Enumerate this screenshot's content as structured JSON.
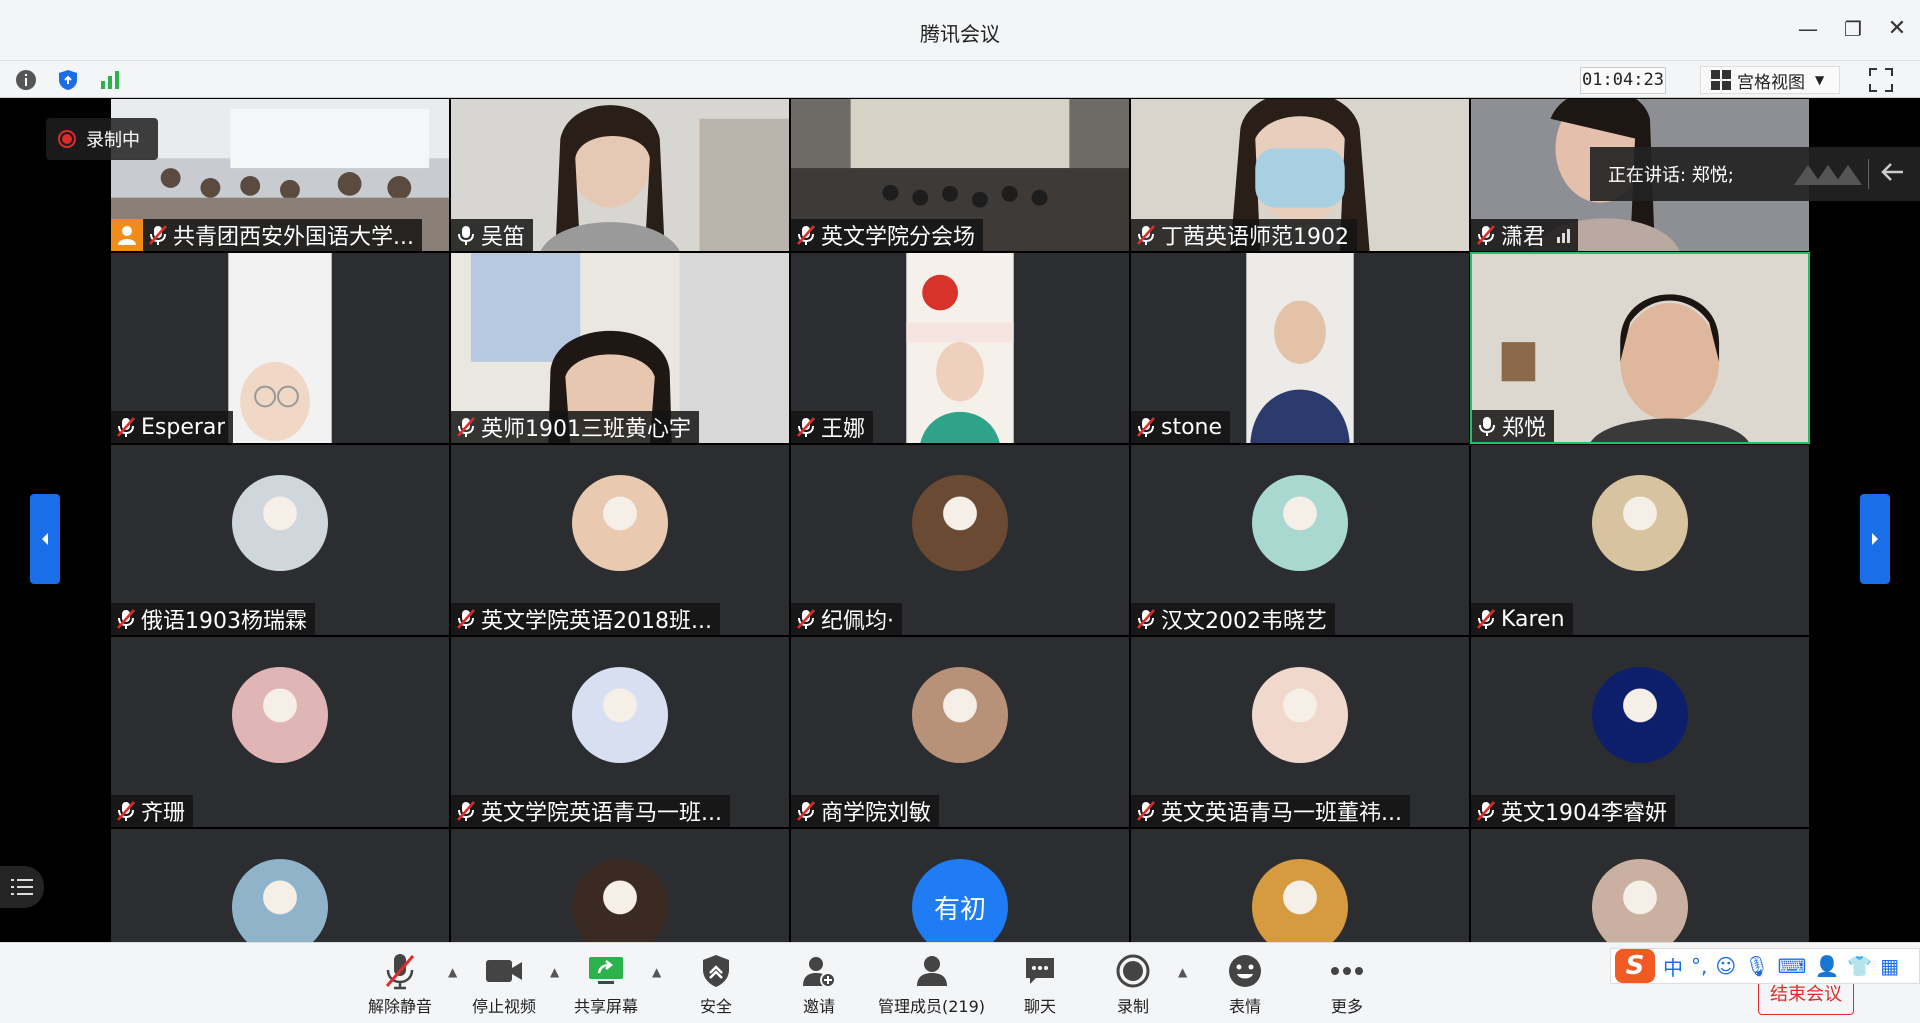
{
  "window": {
    "title": "腾讯会议",
    "min_icon": "minimize-icon",
    "max_icon": "restore-icon",
    "close_icon": "close-icon"
  },
  "subbar": {
    "timer": "01:04:23",
    "view_label": "宫格视图"
  },
  "recording": {
    "label": "录制中"
  },
  "speaking": {
    "label": "正在讲话: 郑悦;"
  },
  "tiles": [
    {
      "name": "共青团西安外国语大学...",
      "mic": "muted",
      "host": true,
      "video": "classroom"
    },
    {
      "name": "吴笛",
      "mic": "on",
      "video": "person"
    },
    {
      "name": "英文学院分会场",
      "mic": "muted",
      "video": "hall"
    },
    {
      "name": "丁茜英语师范1902",
      "mic": "muted",
      "video": "mask"
    },
    {
      "name": "潇君",
      "mic": "muted",
      "video": "person2",
      "level": true
    },
    {
      "name": "Esperar",
      "mic": "muted",
      "video": "narrow"
    },
    {
      "name": "英师1901三班黄心宇",
      "mic": "muted",
      "video": "room"
    },
    {
      "name": "王娜",
      "mic": "muted",
      "video": "narrow2"
    },
    {
      "name": "stone",
      "mic": "muted",
      "video": "narrow3"
    },
    {
      "name": "郑悦",
      "mic": "on",
      "video": "speaker",
      "speaking": true
    },
    {
      "name": "俄语1903杨瑞霖",
      "mic": "muted",
      "avatar": "#cfd6dc"
    },
    {
      "name": "英文学院英语2018班...",
      "mic": "muted",
      "avatar": "#e9c9b0"
    },
    {
      "name": "纪佩均·",
      "mic": "muted",
      "avatar": "#6b4a34"
    },
    {
      "name": "汉文2002韦晓艺",
      "mic": "muted",
      "avatar": "#a8d8d0"
    },
    {
      "name": "Karen",
      "mic": "muted",
      "avatar": "#d8c3a0"
    },
    {
      "name": "齐珊",
      "mic": "muted",
      "avatar": "#e0b5b5"
    },
    {
      "name": "英文学院英语青马一班...",
      "mic": "muted",
      "avatar": "#d7dff0"
    },
    {
      "name": "商学院刘敏",
      "mic": "muted",
      "avatar": "#b89278"
    },
    {
      "name": "英文英语青马一班董祎...",
      "mic": "muted",
      "avatar": "#f0d8cc"
    },
    {
      "name": "英文1904李睿妍",
      "mic": "muted",
      "avatar": "#0d1e6b"
    },
    {
      "name": "",
      "avatar": "#8fb3c8"
    },
    {
      "name": "",
      "avatar": "#3a2a22"
    },
    {
      "name": "",
      "avatar_text": "有初"
    },
    {
      "name": "",
      "avatar": "#d69a40"
    },
    {
      "name": "",
      "avatar": "#c9b0a0"
    }
  ],
  "toolbar": {
    "unmute": "解除静音",
    "stop_video": "停止视频",
    "share": "共享屏幕",
    "security": "安全",
    "invite": "邀请",
    "members": "管理成员(219)",
    "chat": "聊天",
    "record": "录制",
    "emoji": "表情",
    "more": "更多",
    "end": "结束会议"
  },
  "ime": {
    "mode": "中"
  },
  "colors": {
    "accent": "#1a6ee8",
    "speaking_border": "#1ec26b",
    "rec_red": "#e02b2b",
    "host_orange": "#f08c1a"
  }
}
